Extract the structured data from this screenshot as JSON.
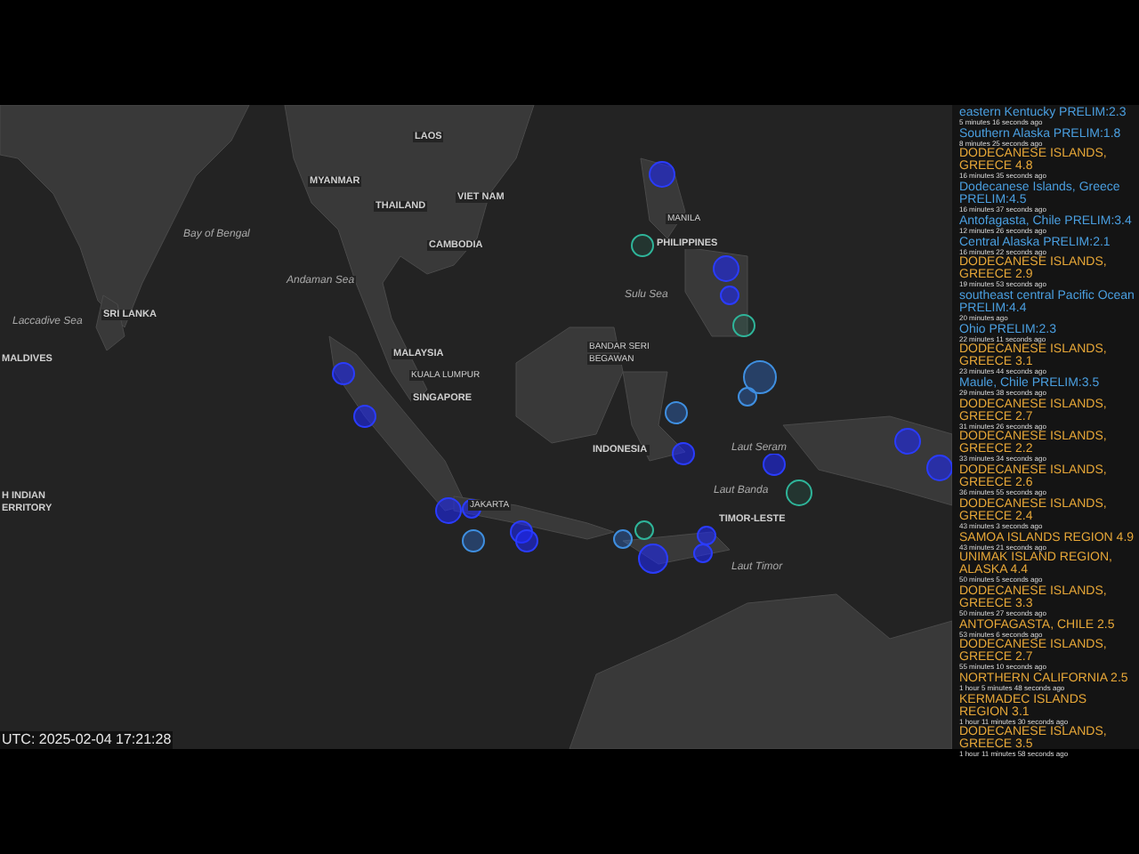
{
  "map": {
    "labels": [
      {
        "text": "LAOS",
        "kind": "country"
      },
      {
        "text": "MYANMAR",
        "kind": "country"
      },
      {
        "text": "THAILAND",
        "kind": "country"
      },
      {
        "text": "VIET NAM",
        "kind": "country"
      },
      {
        "text": "CAMBODIA",
        "kind": "country"
      },
      {
        "text": "Bay of Bengal",
        "kind": "sea"
      },
      {
        "text": "Andaman Sea",
        "kind": "sea"
      },
      {
        "text": "SRI LANKA",
        "kind": "country"
      },
      {
        "text": "Laccadive Sea",
        "kind": "sea"
      },
      {
        "text": "MALDIVES",
        "kind": "country"
      },
      {
        "text": "MALAYSIA",
        "kind": "country"
      },
      {
        "text": "KUALA LUMPUR",
        "kind": "city"
      },
      {
        "text": "SINGAPORE",
        "kind": "country"
      },
      {
        "text": "PHILIPPINES",
        "kind": "country"
      },
      {
        "text": "MANILA",
        "kind": "city"
      },
      {
        "text": "Sulu Sea",
        "kind": "sea"
      },
      {
        "text": "BANDAR SERI",
        "kind": "city"
      },
      {
        "text": "BEGAWAN",
        "kind": "city"
      },
      {
        "text": "INDONESIA",
        "kind": "country"
      },
      {
        "text": "Laut Seram",
        "kind": "sea"
      },
      {
        "text": "Laut Banda",
        "kind": "sea"
      },
      {
        "text": "JAKARTA",
        "kind": "city"
      },
      {
        "text": "TIMOR-LESTE",
        "kind": "country"
      },
      {
        "text": "Laut Timor",
        "kind": "sea"
      },
      {
        "text": "H INDIAN",
        "kind": "country"
      },
      {
        "text": "ERRITORY",
        "kind": "country"
      }
    ],
    "clock": "UTC: 2025-02-04 17:21:28"
  },
  "events": [
    {
      "title": "eastern Kentucky PRELIM:2.3",
      "time": "5 minutes 16 seconds ago",
      "color": "#4a9fe0"
    },
    {
      "title": "Southern Alaska PRELIM:1.8",
      "time": "8 minutes 25 seconds ago",
      "color": "#4a9fe0"
    },
    {
      "title": "DODECANESE ISLANDS, GREECE 4.8",
      "time": "16 minutes 35 seconds ago",
      "color": "#e8a838"
    },
    {
      "title": "Dodecanese Islands, Greece PRELIM:4.5",
      "time": "16 minutes 37 seconds ago",
      "color": "#4a9fe0"
    },
    {
      "title": "Antofagasta, Chile PRELIM:3.4",
      "time": "12 minutes 26 seconds ago",
      "color": "#4a9fe0"
    },
    {
      "title": "Central Alaska PRELIM:2.1",
      "time": "16 minutes 22 seconds ago",
      "color": "#4a9fe0"
    },
    {
      "title": "DODECANESE ISLANDS, GREECE 2.9",
      "time": "19 minutes 53 seconds ago",
      "color": "#e8a838"
    },
    {
      "title": "southeast central Pacific Ocean PRELIM:4.4",
      "time": "20 minutes ago",
      "color": "#4a9fe0"
    },
    {
      "title": "Ohio PRELIM:2.3",
      "time": "22 minutes 11 seconds ago",
      "color": "#4a9fe0"
    },
    {
      "title": "DODECANESE ISLANDS, GREECE 3.1",
      "time": "23 minutes 44 seconds ago",
      "color": "#e8a838"
    },
    {
      "title": "Maule, Chile PRELIM:3.5",
      "time": "29 minutes 38 seconds ago",
      "color": "#4a9fe0"
    },
    {
      "title": "DODECANESE ISLANDS, GREECE 2.7",
      "time": "31 minutes 26 seconds ago",
      "color": "#e8a838"
    },
    {
      "title": "DODECANESE ISLANDS, GREECE 2.2",
      "time": "33 minutes 34 seconds ago",
      "color": "#e8a838"
    },
    {
      "title": "DODECANESE ISLANDS, GREECE 2.6",
      "time": "36 minutes 55 seconds ago",
      "color": "#e8a838"
    },
    {
      "title": "DODECANESE ISLANDS, GREECE 2.4",
      "time": "43 minutes 3 seconds ago",
      "color": "#e8a838"
    },
    {
      "title": "SAMOA ISLANDS REGION 4.9",
      "time": "43 minutes 21 seconds ago",
      "color": "#e8a838"
    },
    {
      "title": "UNIMAK ISLAND REGION, ALASKA 4.4",
      "time": "50 minutes 5 seconds ago",
      "color": "#e8a838"
    },
    {
      "title": "DODECANESE ISLANDS, GREECE 3.3",
      "time": "50 minutes 27 seconds ago",
      "color": "#e8a838"
    },
    {
      "title": "ANTOFAGASTA, CHILE 2.5",
      "time": "53 minutes 6 seconds ago",
      "color": "#e8a838"
    },
    {
      "title": "DODECANESE ISLANDS, GREECE 2.7",
      "time": "55 minutes 10 seconds ago",
      "color": "#e8a838"
    },
    {
      "title": "NORTHERN CALIFORNIA 2.5",
      "time": "1 hour 5 minutes 48 seconds ago",
      "color": "#e8a838"
    },
    {
      "title": "KERMADEC ISLANDS REGION 3.1",
      "time": "1 hour 11 minutes 30 seconds ago",
      "color": "#e8a838"
    },
    {
      "title": "DODECANESE ISLANDS, GREECE 3.5",
      "time": "1 hour 11 minutes 58 seconds ago",
      "color": "#e8a838"
    }
  ]
}
